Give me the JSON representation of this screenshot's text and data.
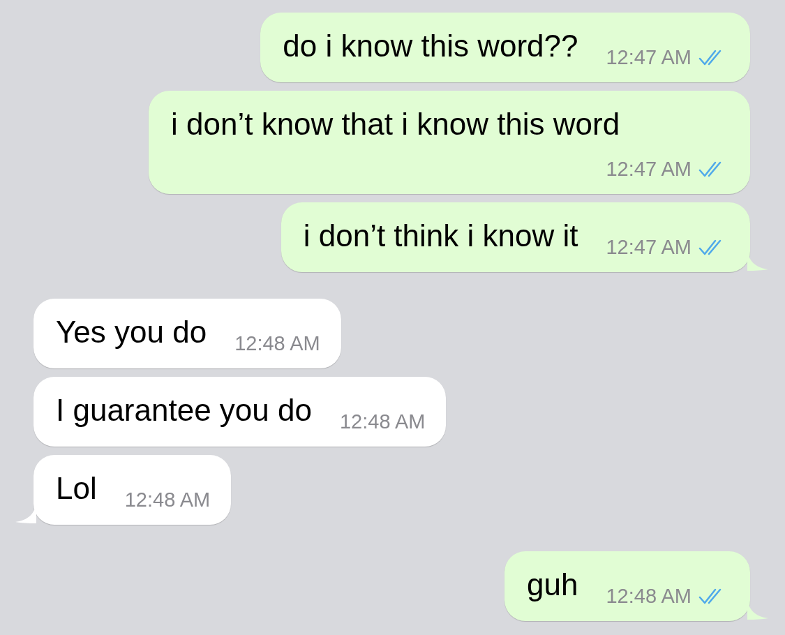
{
  "groups": [
    {
      "kind": "outgoing",
      "messages": [
        {
          "text": "do i know this word??",
          "time": "12:47 AM",
          "read": true
        },
        {
          "text": "i don’t know that i know this word",
          "time": "12:47 AM",
          "read": true
        },
        {
          "text": "i don’t think i know it",
          "time": "12:47 AM",
          "read": true
        }
      ]
    },
    {
      "kind": "incoming",
      "messages": [
        {
          "text": "Yes you do",
          "time": "12:48 AM"
        },
        {
          "text": "I guarantee you do",
          "time": "12:48 AM"
        },
        {
          "text": "Lol",
          "time": "12:48 AM"
        }
      ]
    },
    {
      "kind": "outgoing",
      "messages": [
        {
          "text": "guh",
          "time": "12:48 AM",
          "read": true
        }
      ]
    }
  ]
}
